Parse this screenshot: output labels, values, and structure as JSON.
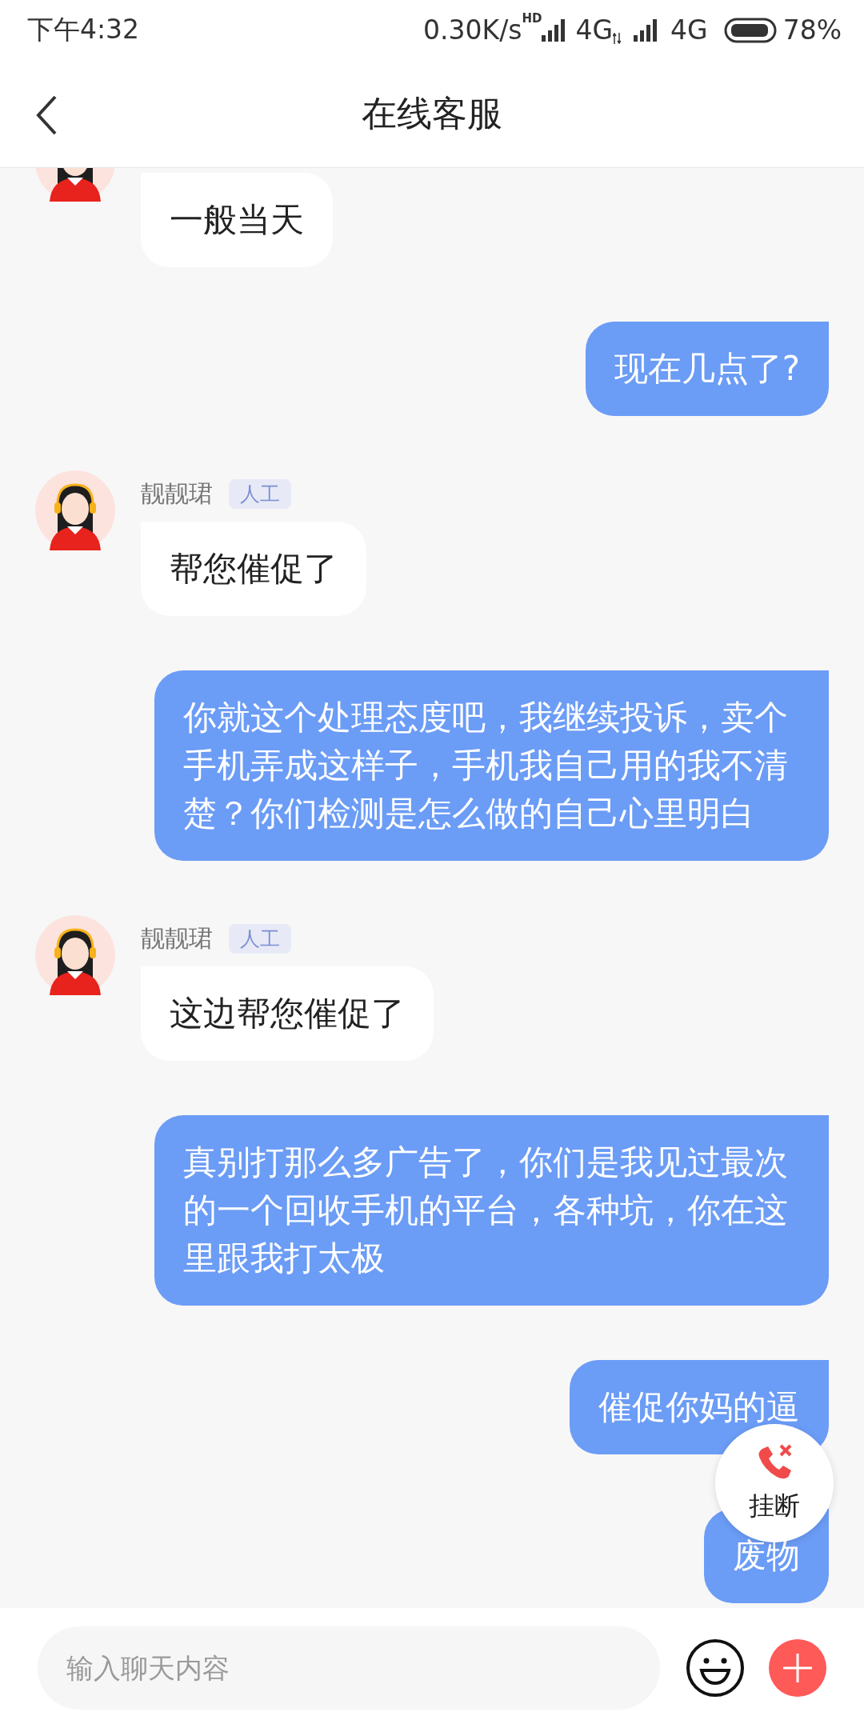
{
  "status_bar": {
    "time": "下午4:32",
    "net_speed": "0.30K/s",
    "hd_label": "HD",
    "network_1": "4G",
    "network_2": "4G",
    "battery": "78%"
  },
  "header": {
    "title": "在线客服"
  },
  "messages": [
    {
      "kind": "agent",
      "text": "一般当天"
    },
    {
      "kind": "user",
      "text": "现在几点了?"
    },
    {
      "kind": "agent",
      "name": "靓靓珺",
      "badge": "人工",
      "text": "帮您催促了"
    },
    {
      "kind": "user",
      "text": "你就这个处理态度吧，我继续投诉，卖个手机弄成这样子，手机我自己用的我不清楚？你们检测是怎么做的自己心里明白"
    },
    {
      "kind": "agent",
      "name": "靓靓珺",
      "badge": "人工",
      "text": "这边帮您催促了"
    },
    {
      "kind": "user",
      "text": "真别打那么多广告了，你们是我见过最次的一个回收手机的平台，各种坑，你在这里跟我打太极"
    },
    {
      "kind": "user",
      "text": "催促你妈的逼"
    },
    {
      "kind": "user",
      "text": "废物"
    }
  ],
  "hang_up_button": {
    "label": "挂断"
  },
  "input_bar": {
    "placeholder": "输入聊天内容"
  }
}
